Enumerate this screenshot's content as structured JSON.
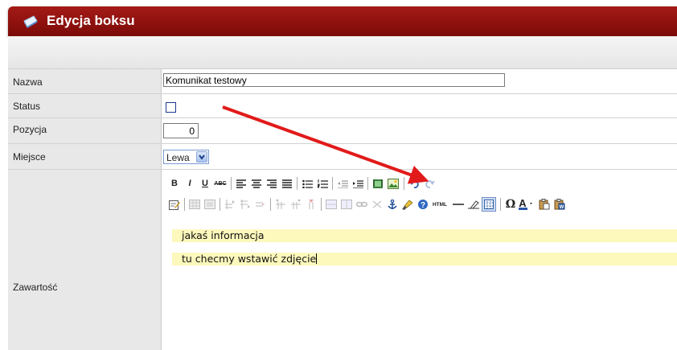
{
  "window": {
    "title": "Edycja boksu"
  },
  "form": {
    "name": {
      "label": "Nazwa",
      "value": "Komunikat testowy"
    },
    "status": {
      "label": "Status",
      "checked": false
    },
    "position": {
      "label": "Pozycja",
      "value": "0"
    },
    "place": {
      "label": "Miejsce",
      "selected": "Lewa"
    },
    "content": {
      "label": "Zawartość",
      "paragraphs": [
        "jakaś informacja",
        "tu checmy wstawić zdjęcie"
      ]
    }
  },
  "toolbar_row1": [
    {
      "icon": "B",
      "name": "bold-icon"
    },
    {
      "icon": "I",
      "name": "italic-icon"
    },
    {
      "icon": "U",
      "name": "underline-icon"
    },
    {
      "icon": "ABC",
      "name": "strikethrough-icon"
    },
    {
      "icon": "≡",
      "name": "align-left-icon"
    },
    {
      "icon": "≡",
      "name": "align-center-icon"
    },
    {
      "icon": "≡",
      "name": "align-right-icon"
    },
    {
      "icon": "≡",
      "name": "align-justify-icon"
    },
    {
      "icon": "☰",
      "name": "bullet-list-icon"
    },
    {
      "icon": "☷",
      "name": "numbered-list-icon"
    },
    {
      "icon": "⇤",
      "name": "outdent-icon"
    },
    {
      "icon": "⇥",
      "name": "indent-icon"
    },
    {
      "icon": "▦",
      "name": "media-icon"
    },
    {
      "icon": "▣",
      "name": "insert-image-icon"
    },
    {
      "icon": "↶",
      "name": "undo-icon"
    },
    {
      "icon": "↷",
      "name": "redo-icon"
    }
  ],
  "toolbar_row2": [
    "edit-icon",
    "table-icon",
    "table-props-icon",
    "row-before-icon",
    "row-after-icon",
    "delete-row-icon",
    "col-before-icon",
    "col-after-icon",
    "delete-col-icon",
    "merge-cells-icon",
    "split-cells-icon",
    "link-icon",
    "unlink-icon",
    "anchor-icon",
    "cleanup-icon",
    "help-icon",
    "html-icon",
    "hr-icon",
    "remove-format-icon",
    "visual-aid-icon",
    "special-char-icon",
    "font-color-icon",
    "paste-icon",
    "paste-word-icon"
  ],
  "toolbar_labels": {
    "html": "HTML",
    "omega": "Ω",
    "font_color": "A"
  }
}
